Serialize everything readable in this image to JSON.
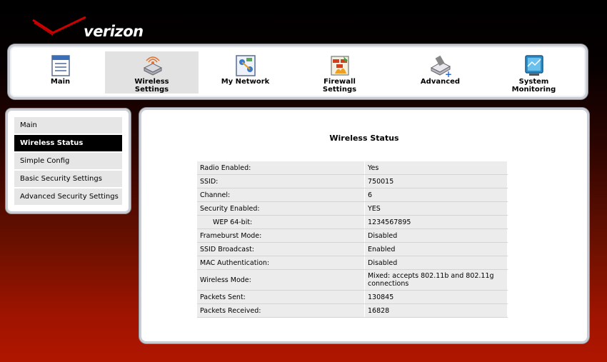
{
  "brand": {
    "name": "verizon"
  },
  "nav": [
    {
      "label": "Main",
      "icon": "document-list-icon",
      "active": false
    },
    {
      "label": "Wireless\nSettings",
      "icon": "wireless-router-icon",
      "active": true
    },
    {
      "label": "My Network",
      "icon": "network-map-icon",
      "active": false
    },
    {
      "label": "Firewall\nSettings",
      "icon": "firewall-icon",
      "active": false
    },
    {
      "label": "Advanced",
      "icon": "advanced-tools-icon",
      "active": false
    },
    {
      "label": "System\nMonitoring",
      "icon": "monitor-icon",
      "active": false
    }
  ],
  "sidebar": {
    "items": [
      {
        "label": "Main"
      },
      {
        "label": "Wireless Status"
      },
      {
        "label": "Simple Config"
      },
      {
        "label": "Basic Security Settings"
      },
      {
        "label": "Advanced Security Settings"
      }
    ]
  },
  "main": {
    "title": "Wireless Status",
    "rows": [
      {
        "key": "Radio Enabled:",
        "value": "Yes"
      },
      {
        "key": "SSID:",
        "value": "750015"
      },
      {
        "key": "Channel:",
        "value": "6"
      },
      {
        "key": "Security Enabled:",
        "value": "YES"
      },
      {
        "key": "WEP 64-bit:",
        "value": "1234567895"
      },
      {
        "key": "Frameburst Mode:",
        "value": "Disabled"
      },
      {
        "key": "SSID Broadcast:",
        "value": "Enabled"
      },
      {
        "key": "MAC Authentication:",
        "value": "Disabled"
      },
      {
        "key": "Wireless Mode:",
        "value": "Mixed: accepts 802.11b and 802.11g connections"
      },
      {
        "key": "Packets Sent:",
        "value": "130845"
      },
      {
        "key": "Packets Received:",
        "value": "16828"
      }
    ]
  },
  "colors": {
    "brand_red": "#cc0000",
    "active_side": "#000000",
    "row_bg": "#ececec"
  }
}
